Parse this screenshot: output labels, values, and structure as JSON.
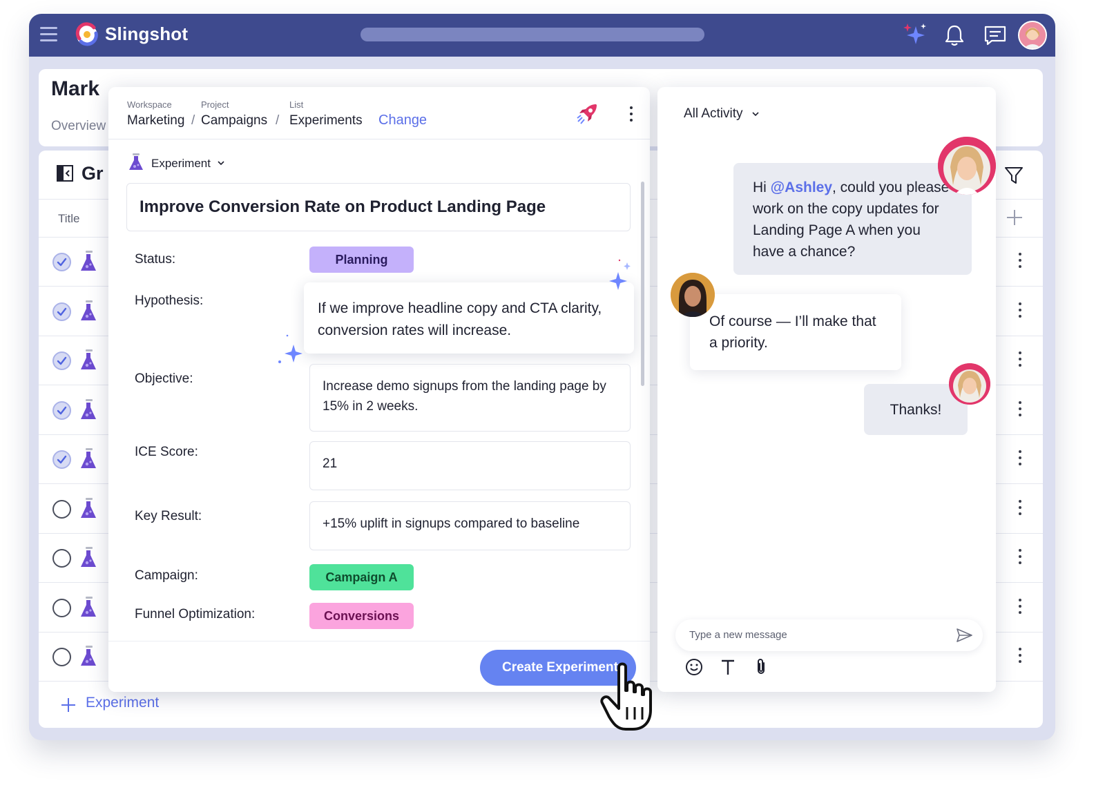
{
  "app": {
    "brand": "Slingshot",
    "colors": {
      "topbar": "#3e4a8e",
      "accent": "#5b6fe8",
      "button": "#6583f1"
    },
    "icons": [
      "menu-icon",
      "slingshot-logo-icon",
      "ai-sparkle-icon",
      "bell-icon",
      "chat-icon",
      "avatar"
    ]
  },
  "background": {
    "title": "Mark",
    "overview": "Overview",
    "group": "Gr",
    "column_title": "Title",
    "add_label": "Experiment",
    "rows": [
      {
        "done": true
      },
      {
        "done": true
      },
      {
        "done": true
      },
      {
        "done": true
      },
      {
        "done": true
      },
      {
        "done": false
      },
      {
        "done": false
      },
      {
        "done": false
      },
      {
        "done": false
      }
    ]
  },
  "form": {
    "breadcrumb": {
      "workspace_label": "Workspace",
      "workspace": "Marketing",
      "project_label": "Project",
      "project": "Campaigns",
      "list_label": "List",
      "list": "Experiments",
      "sep": "/",
      "change": "Change"
    },
    "type": "Experiment",
    "title": "Improve Conversion Rate on Product Landing Page",
    "fields": {
      "status_label": "Status:",
      "status": "Planning",
      "hypothesis_label": "Hypothesis:",
      "hypothesis": "If we improve headline copy and CTA clarity, conversion rates will increase.",
      "objective_label": "Objective:",
      "objective": "Increase demo signups from the landing page by 15% in 2 weeks.",
      "ice_label": "ICE Score:",
      "ice": "21",
      "key_result_label": "Key Result:",
      "key_result": "+15% uplift in signups compared to baseline",
      "campaign_label": "Campaign:",
      "campaign": "Campaign A",
      "funnel_label": "Funnel Optimization:",
      "funnel": "Conversions"
    },
    "pill_colors": {
      "status": "#c4b1fb",
      "campaign": "#4fe29a",
      "funnel": "#fba4de"
    },
    "create_button": "Create Experiment"
  },
  "activity": {
    "filter": "All Activity",
    "messages": {
      "m1_prefix": "Hi ",
      "m1_mention": "@Ashley",
      "m1_rest": ", could you please work on the copy updates for Landing Page A when you have a chance?",
      "m2": "Of course — I’ll make that a priority.",
      "m3": "Thanks!"
    },
    "input_placeholder": "Type a new message",
    "toolbar_icons": [
      "emoji-icon",
      "text-format-icon",
      "attachment-icon"
    ]
  }
}
